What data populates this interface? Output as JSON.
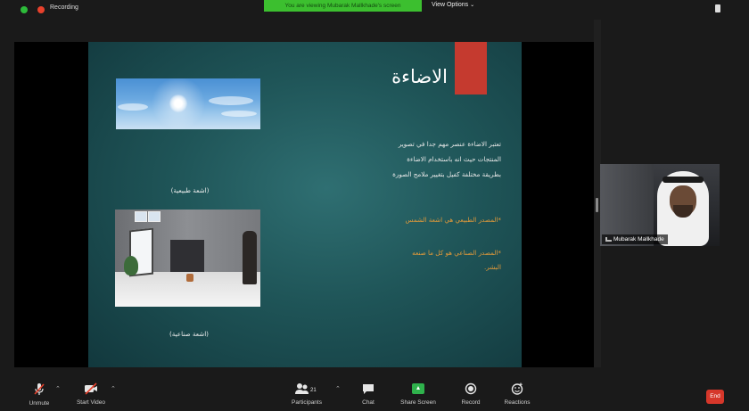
{
  "topbar": {
    "recording_label": "Recording",
    "banner_text": "You are viewing Mubarak Mallkhade's screen",
    "view_options_label": "View Options",
    "view_options_chevron": "⌄"
  },
  "slide": {
    "title": "الاضاءة",
    "body_lines": [
      "تعتبر الاضاءة عنصر مهم جدا في تصوير",
      "المنتجات حيث انه باستخدام الاضاءة",
      "بطريقة مختلفة كفيل بتغيير ملامح الصورة"
    ],
    "bullet_1": "*المصدر الطبيعي هي اشعة الشمس",
    "bullet_2_line1": "*المصدر الصناعي هو كل ما صنعه",
    "bullet_2_line2": "البشر.",
    "caption_natural": "(اشعة طبيعية)",
    "caption_artificial": "(اشعة صناعية)",
    "accent_color": "#c53a2f",
    "orange_color": "#e39a3a"
  },
  "participant": {
    "name": "Mubarak Mallkhade"
  },
  "toolbar": {
    "unmute_label": "Unmute",
    "start_video_label": "Start Video",
    "participants_label": "Participants",
    "participants_count": "21",
    "chat_label": "Chat",
    "share_screen_label": "Share Screen",
    "record_label": "Record",
    "reactions_label": "Reactions",
    "end_label": "End",
    "caret": "⌃"
  },
  "colors": {
    "share_green": "#2fb24c",
    "banner_green": "#3cbf2f",
    "record_red": "#e8412c",
    "end_red": "#d6372a"
  }
}
